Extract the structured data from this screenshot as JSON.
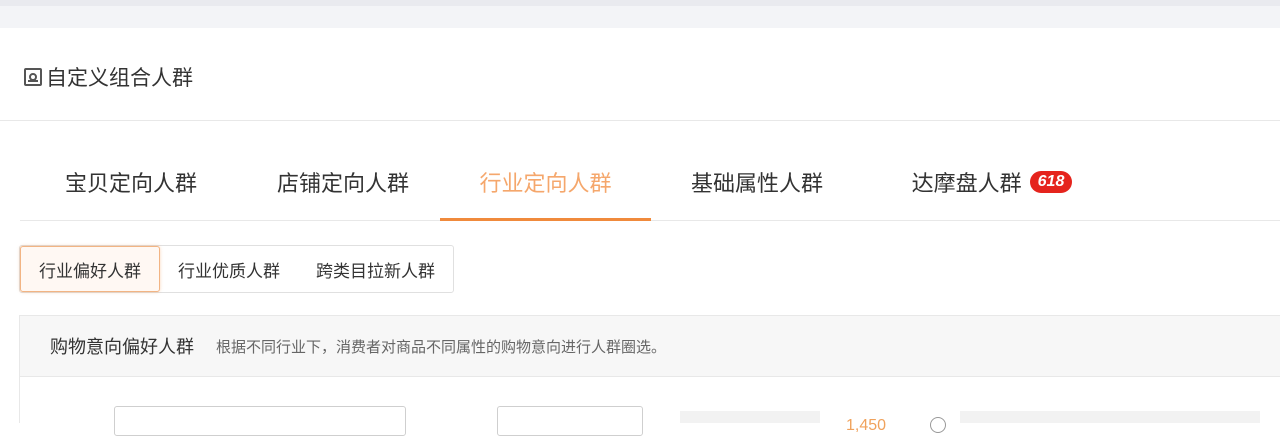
{
  "header": {
    "title": "自定义组合人群",
    "icon": "crowd-icon"
  },
  "tabs": [
    {
      "label": "宝贝定向人群"
    },
    {
      "label": "店铺定向人群"
    },
    {
      "label": "行业定向人群",
      "active": true
    },
    {
      "label": "基础属性人群"
    },
    {
      "label": "达摩盘人群",
      "badge": "618"
    }
  ],
  "subtabs": [
    {
      "label": "行业偏好人群",
      "active": true
    },
    {
      "label": "行业优质人群"
    },
    {
      "label": "跨类目拉新人群"
    }
  ],
  "section": {
    "title": "购物意向偏好人群",
    "description": "根据不同行业下，消费者对商品不同属性的购物意向进行人群圈选。"
  },
  "partial": {
    "number": "1,450"
  },
  "colors": {
    "accent": "#f08a3c",
    "badge": "#e5241d"
  }
}
